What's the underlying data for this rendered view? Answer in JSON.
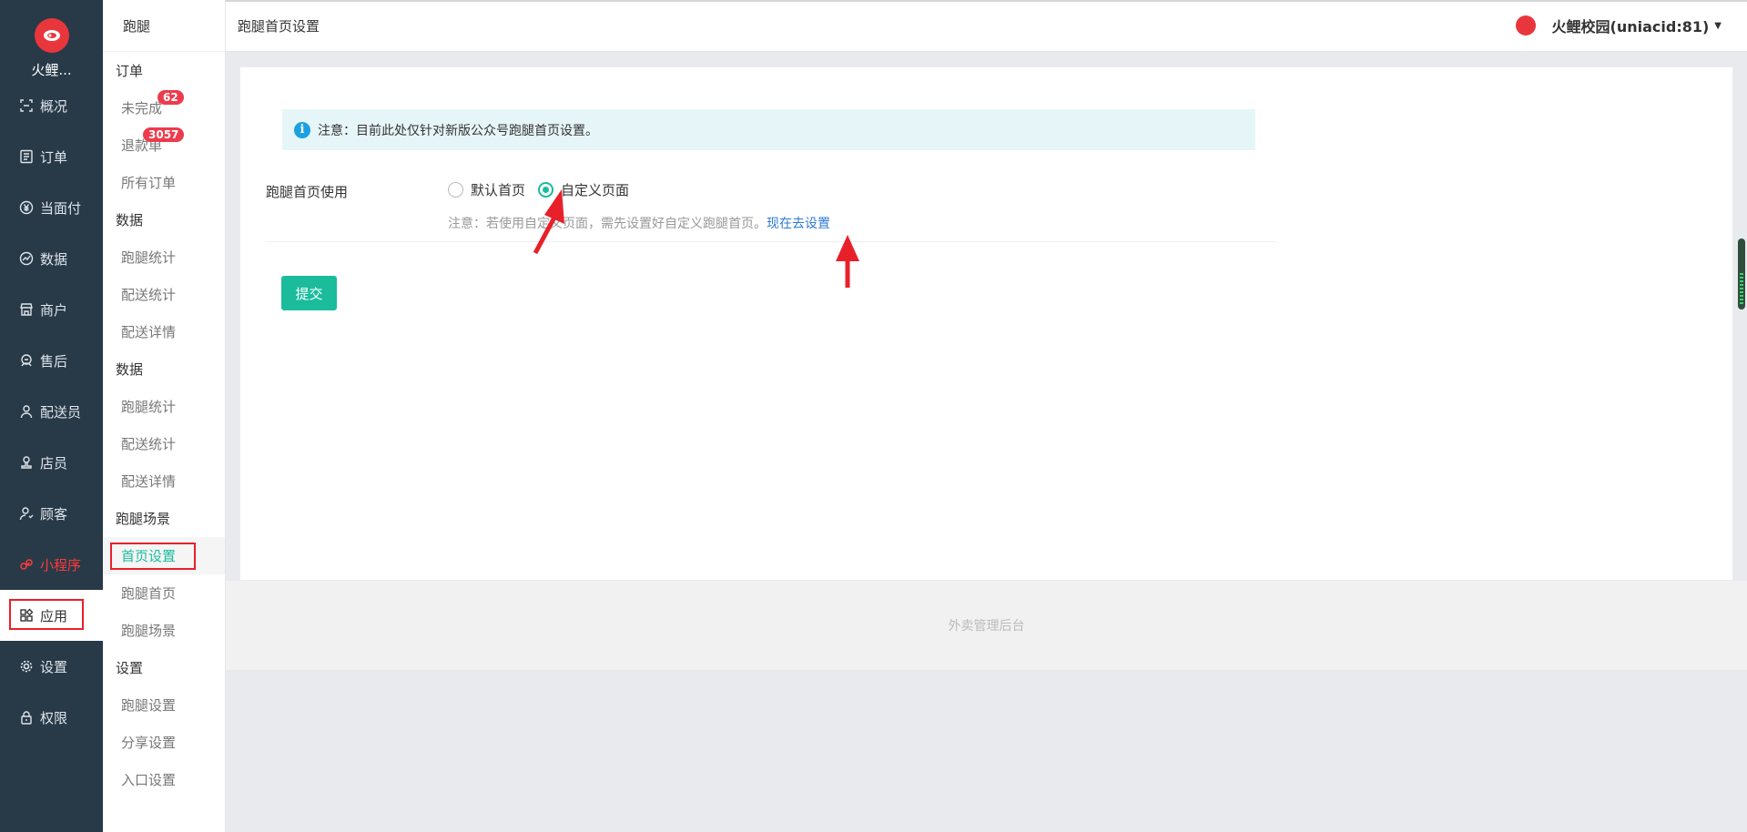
{
  "rail": {
    "logo_name": "火鲤...",
    "items": [
      {
        "label": "概况",
        "icon": "overview-icon"
      },
      {
        "label": "订单",
        "icon": "order-icon"
      },
      {
        "label": "当面付",
        "icon": "yen-icon"
      },
      {
        "label": "数据",
        "icon": "chart-icon"
      },
      {
        "label": "商户",
        "icon": "store-icon"
      },
      {
        "label": "售后",
        "icon": "service-icon"
      },
      {
        "label": "配送员",
        "icon": "courier-icon"
      },
      {
        "label": "店员",
        "icon": "clerk-icon"
      },
      {
        "label": "顾客",
        "icon": "customer-icon"
      },
      {
        "label": "小程序",
        "icon": "miniapp-icon"
      },
      {
        "label": "应用",
        "icon": "apps-icon"
      },
      {
        "label": "设置",
        "icon": "gear-icon"
      },
      {
        "label": "权限",
        "icon": "lock-icon"
      }
    ]
  },
  "side": {
    "head": "跑腿",
    "g1": "订单",
    "l_unfinished": "未完成",
    "b_unfinished": "62",
    "l_refund": "退款单",
    "b_refund": "3057",
    "l_all": "所有订单",
    "g2": "数据",
    "l_stat1": "跑腿统计",
    "l_stat2": "配送统计",
    "l_stat3": "配送详情",
    "g3": "数据",
    "l_stat4": "跑腿统计",
    "l_stat5": "配送统计",
    "l_stat6": "配送详情",
    "g4": "跑腿场景",
    "l_home": "首页设置",
    "l_runhome": "跑腿首页",
    "l_scene": "跑腿场景",
    "g5": "设置",
    "l_set1": "跑腿设置",
    "l_set2": "分享设置",
    "l_set3": "入口设置"
  },
  "topbar": {
    "title": "跑腿首页设置",
    "user": "火鲤校园(uniacid:81)"
  },
  "main": {
    "notice": "注意：目前此处仅针对新版公众号跑腿首页设置。",
    "field_label": "跑腿首页使用",
    "opt_default": "默认首页",
    "opt_custom": "自定义页面",
    "hint": "注意：若使用自定义页面，需先设置好自定义跑腿首页。",
    "hint_link": "现在去设置",
    "submit": "提交"
  },
  "footer": "外卖管理后台",
  "colors": {
    "accent": "#1abc9c",
    "rail_bg": "#283a48",
    "annotation": "#e8202a",
    "link": "#2f7bd1"
  }
}
